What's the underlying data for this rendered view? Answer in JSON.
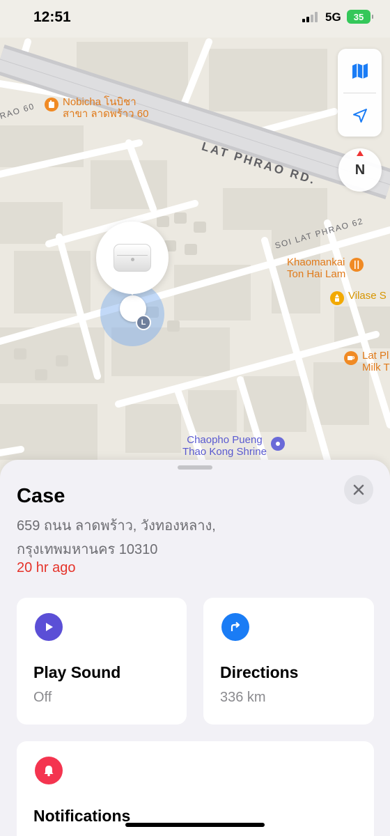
{
  "status_bar": {
    "time": "12:51",
    "network": "5G",
    "battery": "35"
  },
  "map": {
    "streets": {
      "main": "LAT PHRAO RD.",
      "soi": "SOI LAT PHRAO 62",
      "edge": "RAO 60"
    },
    "pois": [
      {
        "name": "Nobicha โนบิชา\nสาขา ลาดพร้าว 60",
        "icon": "food-icon",
        "color": "#f08a24"
      },
      {
        "name": "Khaomankai\nTon Hai Lam",
        "icon": "fork-knife-icon",
        "color": "#f08a24"
      },
      {
        "name": "Vilase S",
        "icon": "temple-icon",
        "color": "#f2a900"
      },
      {
        "name": "Lat Pl\nMilk T",
        "icon": "cafe-icon",
        "color": "#f08a24"
      },
      {
        "name": "Chaopho Pueng\nThao Kong Shrine",
        "icon": "landmark-icon",
        "color": "#6a6ad8"
      }
    ],
    "compass_label": "N",
    "marker_badge": "L"
  },
  "sheet": {
    "title": "Case",
    "address_line1": "659 ถนน ลาดพร้าว, วังทองหลาง,",
    "address_line2": "กรุงเทพมหานคร 10310",
    "last_seen": "20 hr ago",
    "cards": {
      "play_sound": {
        "title": "Play Sound",
        "subtitle": "Off",
        "icon": "play-icon",
        "color": "#5b4fd6"
      },
      "directions": {
        "title": "Directions",
        "subtitle": "336 km",
        "icon": "turn-right-icon",
        "color": "#1a7cf5"
      },
      "notifications": {
        "title": "Notifications",
        "icon": "bell-icon",
        "color": "#f4344f"
      }
    }
  }
}
